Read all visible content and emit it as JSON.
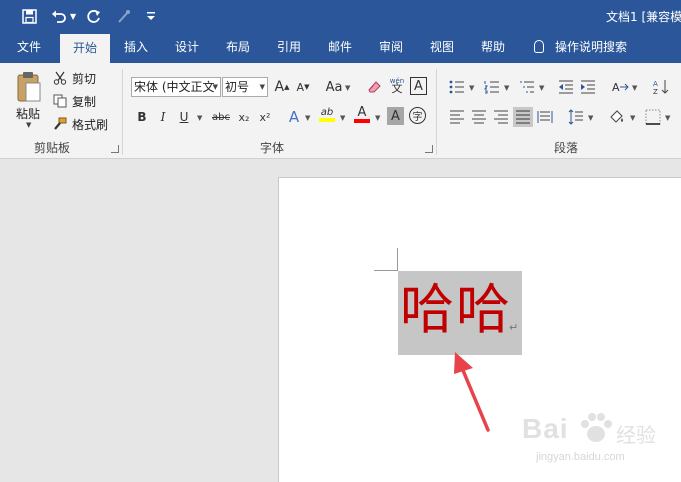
{
  "window": {
    "title": "文档1 [兼容模"
  },
  "quick_access": {
    "save_icon": "save-icon",
    "undo_icon": "undo-icon",
    "redo_icon": "redo-icon",
    "format_painter_icon": "format-painter-icon",
    "customize_icon": "customize-toolbar-icon"
  },
  "tabs": [
    {
      "label": "文件"
    },
    {
      "label": "开始",
      "active": true
    },
    {
      "label": "插入"
    },
    {
      "label": "设计"
    },
    {
      "label": "布局"
    },
    {
      "label": "引用"
    },
    {
      "label": "邮件"
    },
    {
      "label": "审阅"
    },
    {
      "label": "视图"
    },
    {
      "label": "帮助"
    }
  ],
  "tell_me": {
    "label": "操作说明搜索"
  },
  "clipboard": {
    "group_label": "剪贴板",
    "paste": "粘贴",
    "cut": "剪切",
    "copy": "复制",
    "format_painter": "格式刷"
  },
  "font": {
    "group_label": "字体",
    "font_name": "宋体 (中文正文",
    "font_size": "初号",
    "grow": "A",
    "shrink": "A",
    "change_case": "Aa",
    "pinyin": "wén",
    "pinyin_char": "文",
    "char_border": "A",
    "bold": "B",
    "italic": "I",
    "underline": "U",
    "strikethrough": "abc",
    "subscript": "x₂",
    "superscript": "x²",
    "text_effects": "A",
    "highlight": "ab",
    "font_color": "A",
    "char_shading": "A",
    "enclosed": "字",
    "highlight_color": "#ffff00",
    "font_color_value": "#ff0000"
  },
  "paragraph": {
    "group_label": "段落"
  },
  "document": {
    "text": "哈哈",
    "paragraph_mark": "↵",
    "text_color": "#c00000"
  },
  "annotation": {
    "arrow_color": "#e8434b"
  },
  "watermark": {
    "brand": "Bai",
    "cn": "经验",
    "url": "jingyan.baidu.com"
  },
  "colors": {
    "brand_blue": "#2b579a",
    "ribbon_bg": "#f3f3f3",
    "workspace_bg": "#e6e6e6"
  }
}
